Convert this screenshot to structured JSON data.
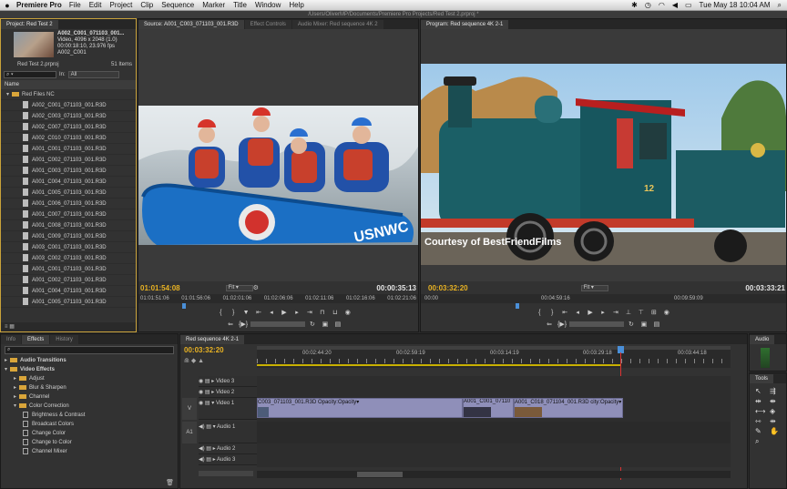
{
  "menubar": {
    "app": "Premiere Pro",
    "items": [
      "File",
      "Edit",
      "Project",
      "Clip",
      "Sequence",
      "Marker",
      "Title",
      "Window",
      "Help"
    ],
    "clock": "Tue May 18  10:04 AM"
  },
  "path": "/Users/OliverMP/Documents/Premiere Pro Projects/Red Test 2.prproj *",
  "project": {
    "tab": "Project: Red Test 2",
    "clip_name": "A002_C001_071103_001...",
    "clip_info1": "Video, 4096 x 2048 (1.0)",
    "clip_info2": "00:00:18:10, 23.976 fps",
    "clip_info3": "A002_C001",
    "project_file": "Red Test 2.prproj",
    "item_count": "51 Items",
    "in_label": "In:",
    "in_value": "All",
    "name_header": "Name",
    "folder": "Red Files NC",
    "files": [
      "A002_C001_071103_001.R3D",
      "A002_C003_071103_001.R3D",
      "A002_C007_071103_001.R3D",
      "A002_C010_071103_001.R3D",
      "A001_C001_071103_001.R3D",
      "A001_C002_071103_001.R3D",
      "A001_C003_071103_001.R3D",
      "A001_C004_071103_001.R3D",
      "A001_C005_071103_001.R3D",
      "A001_C006_071103_001.R3D",
      "A001_C007_071103_001.R3D",
      "A001_C008_071103_001.R3D",
      "A001_C009_071103_001.R3D",
      "A003_C001_071103_001.R3D",
      "A003_C002_071103_001.R3D",
      "A001_C001_071103_001.R3D",
      "A001_C002_071103_001.R3D",
      "A001_C004_071103_001.R3D",
      "A001_C005_071103_001.R3D"
    ]
  },
  "source": {
    "tabs": [
      "Source: A001_C003_071103_001.R3D",
      "Effect Controls",
      "Audio Mixer: Red sequence 4K 2"
    ],
    "tc_left": "01:01:54:08",
    "fit": "Fit",
    "tc_right": "00:00:35:13",
    "ruler": [
      "01:01:51:06",
      "01:01:56:06",
      "01:02:01:06",
      "01:02:06:06",
      "01:02:11:06",
      "01:02:16:06",
      "01:02:21:06"
    ]
  },
  "program": {
    "tab": "Program: Red sequence 4K 2-1",
    "watermark": "Courtesy of BestFriendFilms",
    "tc_left": "00:03:32:20",
    "fit": "Fit",
    "tc_right": "00:03:33:21",
    "ruler": [
      "00:00",
      "00:04:59:16",
      "00:09:59:09"
    ],
    "train_number": "12"
  },
  "effects": {
    "tabs": [
      "Info",
      "Effects",
      "History"
    ],
    "items": [
      {
        "label": "Audio Transitions",
        "level": 0,
        "type": "folder"
      },
      {
        "label": "Video Effects",
        "level": 0,
        "type": "folder"
      },
      {
        "label": "Adjust",
        "level": 1,
        "type": "folder"
      },
      {
        "label": "Blur & Sharpen",
        "level": 1,
        "type": "folder"
      },
      {
        "label": "Channel",
        "level": 1,
        "type": "folder"
      },
      {
        "label": "Color Correction",
        "level": 1,
        "type": "folder"
      },
      {
        "label": "Brightness & Contrast",
        "level": 2,
        "type": "fx"
      },
      {
        "label": "Broadcast Colors",
        "level": 2,
        "type": "fx"
      },
      {
        "label": "Change Color",
        "level": 2,
        "type": "fx"
      },
      {
        "label": "Change to Color",
        "level": 2,
        "type": "fx"
      },
      {
        "label": "Channel Mixer",
        "level": 2,
        "type": "fx"
      }
    ]
  },
  "timeline": {
    "tab": "Red sequence 4K 2-1",
    "timecode": "00:03:32:20",
    "ruler": [
      "00:02:44:20",
      "00:02:59:19",
      "00:03:14:19",
      "00:03:29:18",
      "00:03:44:18"
    ],
    "video_tracks": [
      "Video 3",
      "Video 2",
      "Video 1"
    ],
    "audio_tracks": [
      "Audio 1",
      "Audio 2",
      "Audio 3"
    ],
    "video_target": "V",
    "audio_target": "A1",
    "clips": [
      {
        "label": "C003_071103_001.R3D  Opacity:Opacity▾"
      },
      {
        "label": "A001_C001_07110"
      },
      {
        "label": "A001_C018_071104_001.R3D  city:Opacity▾"
      }
    ]
  },
  "right_panels": {
    "audio_tab": "Audio",
    "tools_tab": "Tools"
  }
}
